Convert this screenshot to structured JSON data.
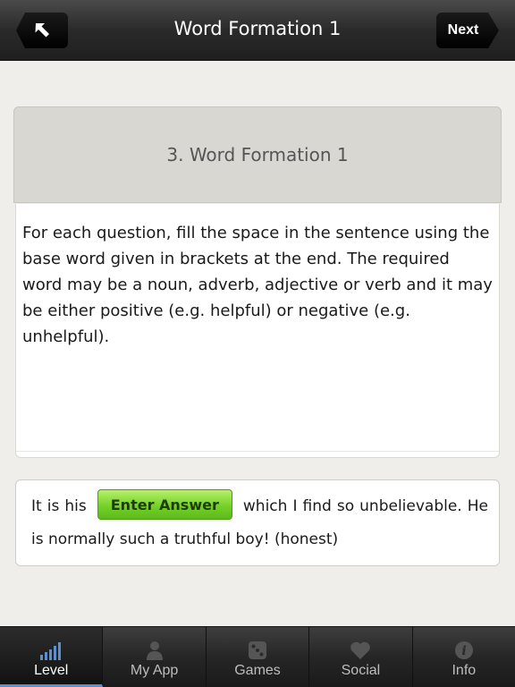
{
  "navbar": {
    "title": "Word Formation 1",
    "next_label": "Next",
    "back_icon": "back-arrow-icon"
  },
  "section": {
    "title": "3. Word Formation 1"
  },
  "instructions": {
    "text": "For each question, fill the space in the sentence using the base word given in brackets at the end. The required word may be a noun, adverb, adjective or verb and it may be either positive (e.g. helpful) or negative (e.g. unhelpful)."
  },
  "question": {
    "before": "It is his",
    "button_label": "Enter Answer",
    "after": "which I find so unbelievable. He is normally such a truthful boy! (honest)"
  },
  "tabs": [
    {
      "label": "Level",
      "icon": "level-bars-icon",
      "active": true
    },
    {
      "label": "My App",
      "icon": "person-icon",
      "active": false
    },
    {
      "label": "Games",
      "icon": "dice-icon",
      "active": false
    },
    {
      "label": "Social",
      "icon": "heart-icon",
      "active": false
    },
    {
      "label": "Info",
      "icon": "info-icon",
      "active": false
    }
  ],
  "colors": {
    "accent_green": "#74d12a",
    "active_tab_indicator": "#5b8fd0"
  }
}
